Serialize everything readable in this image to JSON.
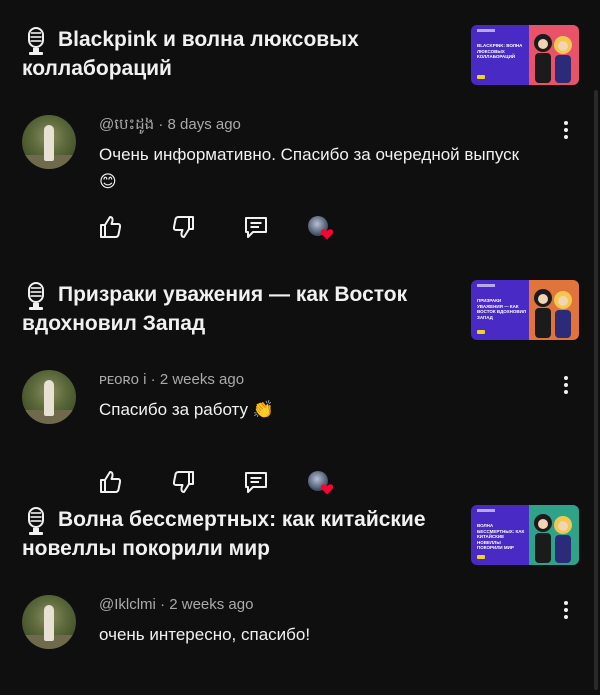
{
  "threads": [
    {
      "video": {
        "title": "Blackpink и волна люксовых коллабораций",
        "thumb_text": "Blackpink: волна люксовых коллабораций",
        "thumb_bg": "#4a2ac4",
        "thumb_art": "#e8536a"
      },
      "comment": {
        "author": "@បេះដូង",
        "time": "8 days ago",
        "text": "Очень информативно. Спасибо за очередной выпуск 😊"
      }
    },
    {
      "video": {
        "title": "Призраки уважения — как Восток вдохновил Запад",
        "thumb_text": "Призраки уважения — как восток вдохновил запад",
        "thumb_bg": "#4a2ac4",
        "thumb_art": "#e0743a"
      },
      "comment": {
        "author": "ᴘᴇᴏʀᴏ i",
        "time": "2 weeks ago",
        "text": "Спасибо за работу 👏"
      }
    },
    {
      "video": {
        "title": "Волна бессмертных: как китайские новеллы покорили мир",
        "thumb_text": "Волна бессмертных: как китайские новеллы покорили мир",
        "thumb_bg": "#4a2ac4",
        "thumb_art": "#2fa38a"
      },
      "comment": {
        "author": "@Iklclmi",
        "time": "2 weeks ago",
        "text": "очень интересно, спасибо!"
      }
    }
  ],
  "icons": {
    "video": "microphone-icon",
    "like": "thumbs-up-icon",
    "dislike": "thumbs-down-icon",
    "reply": "reply-comment-icon",
    "more": "more-vertical-icon",
    "creator_heart": "creator-heart-icon"
  },
  "separator": "·"
}
